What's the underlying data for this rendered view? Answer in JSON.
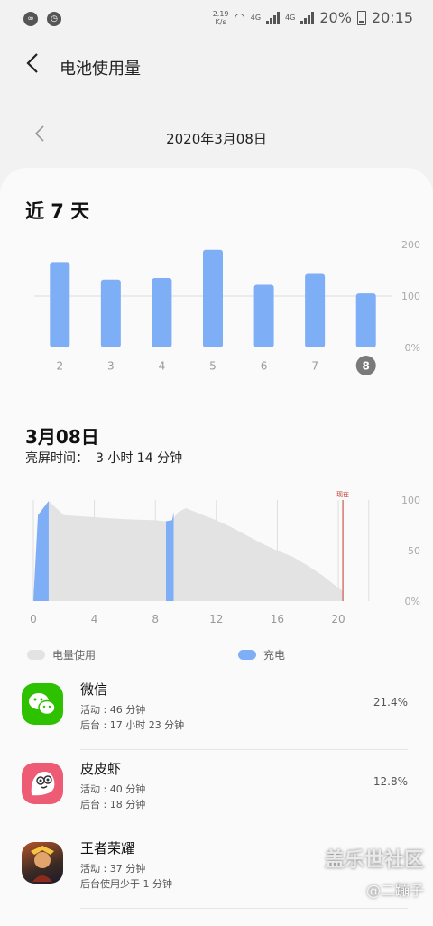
{
  "status_bar": {
    "speed_value": "2.19",
    "speed_unit": "K/s",
    "network_1": "4G",
    "network_2": "4G",
    "battery": "20%",
    "time": "20:15"
  },
  "app_bar": {
    "title": "电池使用量"
  },
  "date_nav": {
    "date": "2020年3月08日"
  },
  "week_section": {
    "title": "近 7 天"
  },
  "day_section": {
    "title": "3月08日",
    "screen_time_label": "亮屏时间：",
    "screen_time_value": "3 小时 14 分钟"
  },
  "legend": {
    "usage": "电量使用",
    "charging": "充电"
  },
  "colors": {
    "bar_blue": "#7eaef6",
    "usage_gray": "#e3e3e3",
    "selected_day": "#7a7a7a",
    "now_line": "#c0392b"
  },
  "chart_data": [
    {
      "type": "bar",
      "title": "近 7 天",
      "categories": [
        "2",
        "3",
        "4",
        "5",
        "6",
        "7",
        "8"
      ],
      "values": [
        166,
        132,
        135,
        190,
        122,
        143,
        105
      ],
      "selected_category": "8",
      "y_tick_labels": [
        "200",
        "100",
        "0%"
      ],
      "ylim": [
        0,
        200
      ],
      "grid": true
    },
    {
      "type": "area",
      "title": "3月08日",
      "x_tick_labels": [
        "0",
        "4",
        "8",
        "12",
        "16",
        "20"
      ],
      "y_tick_labels": [
        "100",
        "50",
        "0%"
      ],
      "xlim": [
        0,
        24
      ],
      "ylim": [
        0,
        100
      ],
      "now_label": "现在",
      "now_x": 20.3,
      "usage_series": {
        "name": "电量使用",
        "x": [
          0,
          0.3,
          1,
          1.5,
          2,
          4,
          6,
          8,
          8.7,
          9.1,
          9.5,
          10,
          11,
          12,
          13,
          14,
          15,
          16,
          17,
          18,
          19,
          20,
          20.3
        ],
        "y": [
          0,
          85,
          99,
          92,
          85,
          83,
          81,
          80,
          79,
          80,
          88,
          92,
          86,
          80,
          73,
          65,
          57,
          50,
          44,
          35,
          25,
          13,
          10
        ]
      },
      "charging_series": {
        "name": "充电",
        "periods": [
          [
            0,
            1.0
          ],
          [
            8.7,
            9.2
          ]
        ]
      }
    }
  ],
  "apps": [
    {
      "name": "微信",
      "line1": "活动 : 46 分钟",
      "line2": "后台 : 17 小时 23 分钟",
      "percent": "21.4%",
      "icon": "wechat-icon",
      "color": "#2dc100"
    },
    {
      "name": "皮皮虾",
      "line1": "活动 : 40 分钟",
      "line2": "后台 : 18 分钟",
      "percent": "12.8%",
      "icon": "pipixia-icon",
      "color": "#ee5b74"
    },
    {
      "name": "王者荣耀",
      "line1": "活动 : 37 分钟",
      "line2": "后台使用少于 1 分钟",
      "percent": "",
      "icon": "honor-of-kings-icon",
      "color": "#3a2a24"
    }
  ],
  "watermark": {
    "site": "盖乐世社区",
    "user": "@二蹦子"
  }
}
